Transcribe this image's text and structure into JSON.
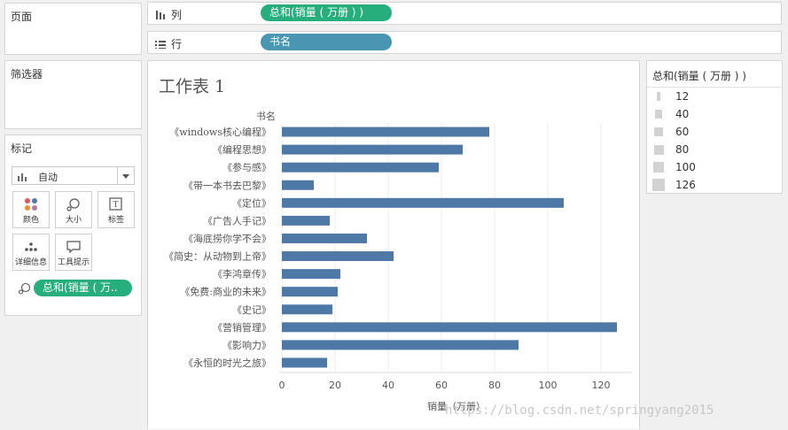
{
  "pages": {
    "title": "页面"
  },
  "filters": {
    "title": "筛选器"
  },
  "marks": {
    "title": "标记",
    "mark_type": "自动",
    "cards": [
      {
        "label": "颜色",
        "icon": "color-icon"
      },
      {
        "label": "大小",
        "icon": "size-icon"
      },
      {
        "label": "标签",
        "icon": "label-icon"
      },
      {
        "label": "详细信息",
        "icon": "detail-icon"
      },
      {
        "label": "工具提示",
        "icon": "tooltip-icon"
      }
    ],
    "size_pill": "总和(销量 ( 万.."
  },
  "shelves": {
    "columns": {
      "label": "列",
      "pill": "总和(销量 ( 万册 ) )"
    },
    "rows": {
      "label": "行",
      "pill": "书名"
    }
  },
  "sheet_title": "工作表 1",
  "legend": {
    "title": "总和(销量 ( 万册 ) )",
    "items": [
      {
        "value": 12
      },
      {
        "value": 40
      },
      {
        "value": 60
      },
      {
        "value": 80
      },
      {
        "value": 100
      },
      {
        "value": 126
      }
    ]
  },
  "watermark": "https://blog.csdn.net/springyang2015",
  "colors": {
    "bar": "#4e79a7",
    "measure_pill": "#27ae7d",
    "dimension_pill": "#4996b2"
  },
  "chart_data": {
    "type": "bar",
    "orientation": "horizontal",
    "category_header": "书名",
    "xlabel": "销量（万册）",
    "xlim": [
      0,
      130
    ],
    "xticks": [
      0,
      20,
      40,
      60,
      80,
      100,
      120
    ],
    "grid": true,
    "categories": [
      "《windows核心编程》",
      "《编程思想》",
      "《参与感》",
      "《带一本书去巴黎》",
      "《定位》",
      "《广告人手记》",
      "《海底捞你学不会》",
      "《简史：从动物到上帝》",
      "《李鸿章传》",
      "《免费:商业的未来》",
      "《史记》",
      "《营销管理》",
      "《影响力》",
      "《永恒的时光之旅》"
    ],
    "values": [
      78,
      68,
      59,
      12,
      106,
      18,
      32,
      42,
      22,
      21,
      19,
      126,
      89,
      17
    ]
  }
}
